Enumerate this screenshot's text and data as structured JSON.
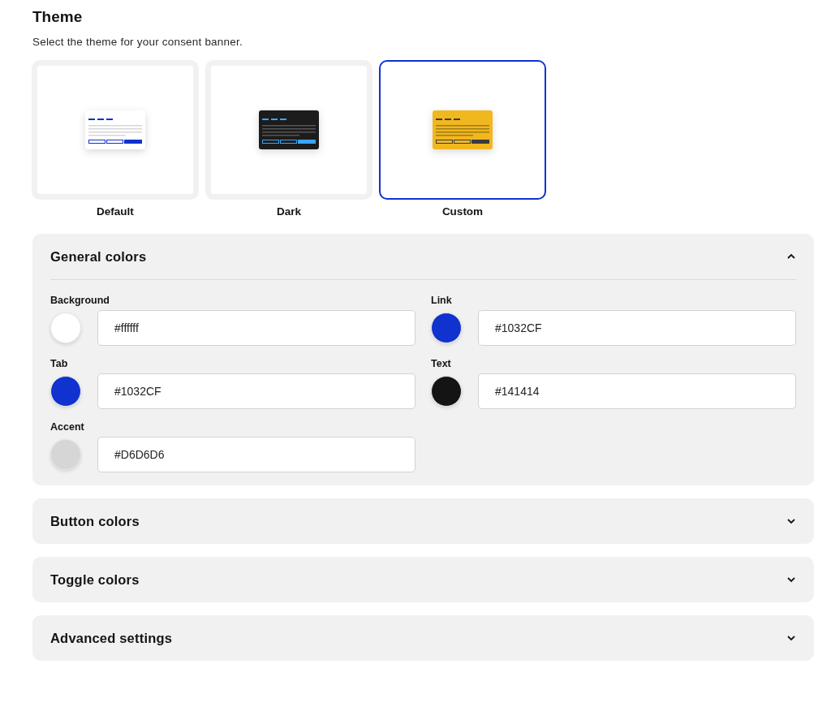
{
  "theme": {
    "title": "Theme",
    "description": "Select the theme for your consent banner.",
    "options": [
      {
        "label": "Default",
        "kind": "default",
        "selected": false
      },
      {
        "label": "Dark",
        "kind": "dark",
        "selected": false
      },
      {
        "label": "Custom",
        "kind": "custom",
        "selected": true
      }
    ]
  },
  "sections": [
    {
      "title": "General colors",
      "expanded": true,
      "fields": [
        {
          "label": "Background",
          "value": "#ffffff",
          "color": "#ffffff"
        },
        {
          "label": "Link",
          "value": "#1032CF",
          "color": "#1032cf"
        },
        {
          "label": "Tab",
          "value": "#1032CF",
          "color": "#1032cf"
        },
        {
          "label": "Text",
          "value": "#141414",
          "color": "#141414"
        },
        {
          "label": "Accent",
          "value": "#D6D6D6",
          "color": "#d6d6d6"
        }
      ]
    },
    {
      "title": "Button colors",
      "expanded": false
    },
    {
      "title": "Toggle colors",
      "expanded": false
    },
    {
      "title": "Advanced settings",
      "expanded": false
    }
  ]
}
